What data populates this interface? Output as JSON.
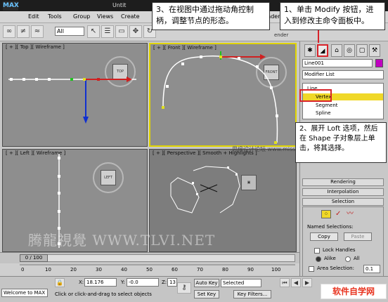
{
  "app": {
    "logo": "MAX",
    "title": "Untit"
  },
  "menu": [
    "Edit",
    "Tools",
    "Group",
    "Views",
    "Create",
    "Modifiers",
    "Rendering"
  ],
  "toolbar": {
    "filter": "All",
    "side_label": "ender"
  },
  "viewports": {
    "top": "[ + ][ Top ][ Wireframe ]",
    "front": "[ + ][ Front ][ Wireframe ]",
    "left": "[ + ][ Left ][ Wireframe ]",
    "perspective": "[ + ][ Perspective ][ Smooth + Highlights ]",
    "gizmo_top": "TOP",
    "gizmo_front": "FRONT",
    "gizmo_left": "LEFT"
  },
  "command_panel": {
    "object_name": "Line001",
    "modifier_list": "Modifier List",
    "stack": {
      "root": "Line",
      "vertex": "Vertex",
      "segment": "Segment",
      "spline": "Spline"
    },
    "rollouts": [
      "Rendering",
      "Interpolation",
      "Selection"
    ],
    "named_selections": "Named Selections:",
    "copy": "Copy",
    "paste": "Paste",
    "lock_handles": "Lock Handles",
    "alike": "Alike",
    "all": "All",
    "area_selection": "Area Selection:",
    "area_value": "0.1"
  },
  "callouts": {
    "step1": "1、单击 Modify 按钮，进入到修改主命令面板中。",
    "step2": "2、展开 Loft 选项，然后在 Shape 子对象层上单击，将其选择。",
    "step3": "3、在视图中通过拖动角控制柄，调整节点的形态。"
  },
  "timeline": {
    "position": "0 / 100",
    "ticks": [
      "0",
      "10",
      "20",
      "30",
      "40",
      "50",
      "60",
      "70",
      "80",
      "90",
      "100"
    ]
  },
  "status": {
    "welcome": "Welcome to MAX",
    "prompt": "Click or click-and-drag to select objects",
    "x_label": "X:",
    "x_value": "18.176",
    "y_label": "Y:",
    "y_value": "-0.0",
    "z_label": "Z:",
    "z_value": "13",
    "auto_key": "Auto Key",
    "set_key": "Set Key",
    "selected": "Selected",
    "key_filters": "Key Filters..."
  },
  "watermark": "腾龍視覺 WWW.TLVI.NET",
  "watermark2": "思缘设计论坛 www.missyuan.com",
  "site_logo": "软件自学网",
  "colors": {
    "highlight": "#d8232a",
    "active_viewport": "#e0d400",
    "vertex_row": "#f0d828",
    "object_color": "#c000c0"
  }
}
